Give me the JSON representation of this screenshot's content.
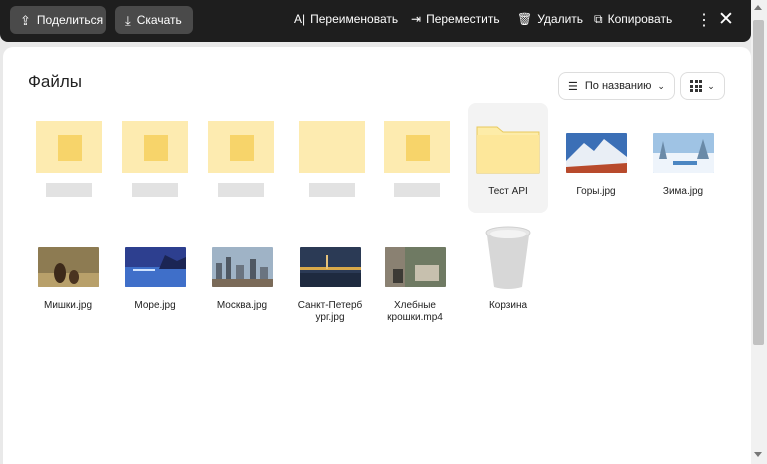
{
  "toolbar": {
    "share_label": "Поделиться",
    "download_label": "Скачать",
    "rename_label": "Переименовать",
    "move_label": "Переместить",
    "delete_label": "Удалить",
    "copy_label": "Копировать"
  },
  "main": {
    "title": "Файлы",
    "sort_label": "По названию"
  },
  "items": [
    {
      "label": "Тест API",
      "type": "folder"
    },
    {
      "label": "Горы.jpg",
      "type": "image"
    },
    {
      "label": "Зима.jpg",
      "type": "image"
    },
    {
      "label": "Мишки.jpg",
      "type": "image"
    },
    {
      "label": "Море.jpg",
      "type": "image"
    },
    {
      "label": "Москва.jpg",
      "type": "image"
    },
    {
      "label": "Санкт-Петерб\nург.jpg",
      "type": "image"
    },
    {
      "label": "Хлебные\nкрошки.mp4",
      "type": "video"
    },
    {
      "label": "Корзина",
      "type": "trash"
    }
  ],
  "colors": {
    "toolbar_bg": "#1e1e1e",
    "folder": "#fdebb0",
    "accent": "#f7d46a"
  }
}
